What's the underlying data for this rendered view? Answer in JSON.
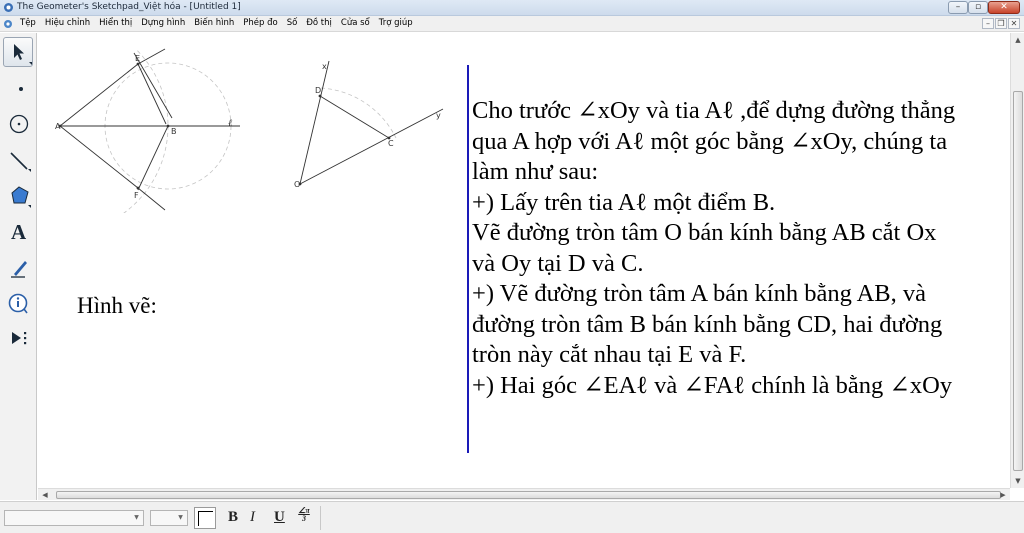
{
  "window": {
    "title": "The Geometer's Sketchpad_Việt hóa - [Untitled 1]"
  },
  "menu": [
    "Tệp",
    "Hiệu chỉnh",
    "Hiển thị",
    "Dựng hình",
    "Biến hình",
    "Phép đo",
    "Số",
    "Đồ thị",
    "Cửa sổ",
    "Trợ giúp"
  ],
  "toolbox": {
    "text_tool_glyph": "A"
  },
  "figure1": {
    "labels": {
      "E": "E",
      "A": "A",
      "B": "B",
      "F": "F",
      "l": "ℓ"
    }
  },
  "figure2": {
    "labels": {
      "x": "x",
      "D": "D",
      "y": "y",
      "C": "C",
      "O": "O"
    }
  },
  "caption": "Hình vẽ:",
  "text_lines": [
    "Cho trước ∠xOy và tia Aℓ ,để dựng đường thẳng",
    "qua A hợp với Aℓ một góc bằng  ∠xOy, chúng ta",
    "làm như sau:",
    "+) Lấy trên tia Aℓ một điểm B.",
    "Vẽ đường tròn tâm O bán kính bằng AB cắt Ox",
    "và Oy tại D và C.",
    "+) Vẽ đường tròn tâm A bán kính bằng AB, và",
    "đường tròn tâm B bán kính bằng CD, hai đường",
    "tròn này cắt nhau tại E và F.",
    "+) Hai góc ∠EAℓ và ∠FAℓ chính là bằng ∠xOy"
  ],
  "format_bar": {
    "bold": "B",
    "italic": "I",
    "underline": "U",
    "symbol_top": "∠π",
    "symbol_bottom": "3"
  },
  "colors": {
    "divider": "#1a1ab8",
    "construction_circle": "#bfbfbf",
    "line": "#333333"
  }
}
